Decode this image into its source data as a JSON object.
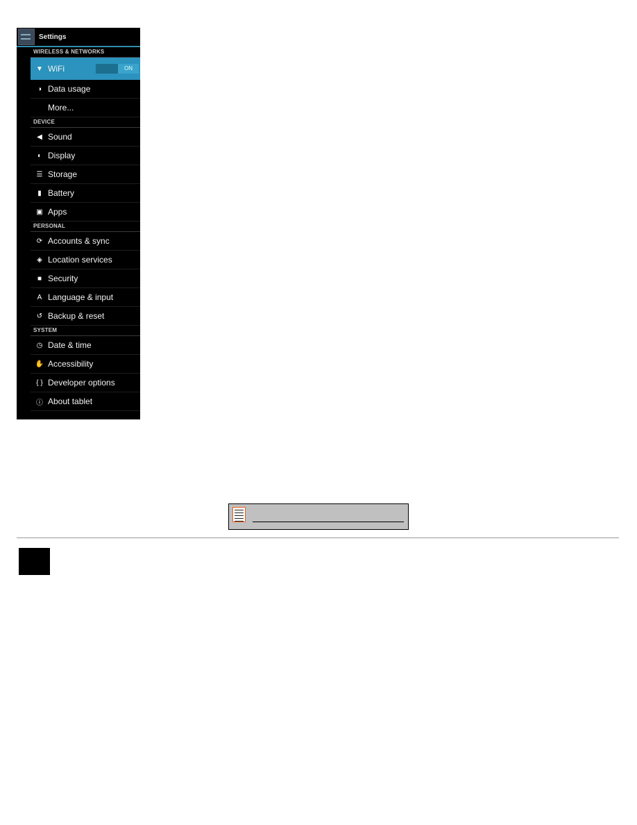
{
  "actionbar": {
    "title": "Settings",
    "icon": "settings-app-icon"
  },
  "sections": [
    {
      "header": "WIRELESS & NETWORKS",
      "items": [
        {
          "label": "WiFi",
          "icon": "wifi-icon",
          "glyph": "▼",
          "active": true,
          "toggle": "ON"
        },
        {
          "label": "Data usage",
          "icon": "data-usage-icon",
          "glyph": "◑"
        },
        {
          "label": "More...",
          "icon": "",
          "glyph": ""
        }
      ]
    },
    {
      "header": "DEVICE",
      "items": [
        {
          "label": "Sound",
          "icon": "sound-icon",
          "glyph": "◀"
        },
        {
          "label": "Display",
          "icon": "display-icon",
          "glyph": "◐"
        },
        {
          "label": "Storage",
          "icon": "storage-icon",
          "glyph": "☰"
        },
        {
          "label": "Battery",
          "icon": "battery-icon",
          "glyph": "▮"
        },
        {
          "label": "Apps",
          "icon": "apps-icon",
          "glyph": "▣"
        }
      ]
    },
    {
      "header": "PERSONAL",
      "items": [
        {
          "label": "Accounts & sync",
          "icon": "sync-icon",
          "glyph": "⟳"
        },
        {
          "label": "Location services",
          "icon": "location-icon",
          "glyph": "◈"
        },
        {
          "label": "Security",
          "icon": "lock-icon",
          "glyph": "■"
        },
        {
          "label": "Language & input",
          "icon": "language-icon",
          "glyph": "A"
        },
        {
          "label": "Backup & reset",
          "icon": "backup-icon",
          "glyph": "↺"
        }
      ]
    },
    {
      "header": "SYSTEM",
      "items": [
        {
          "label": "Date & time",
          "icon": "clock-icon",
          "glyph": "◷"
        },
        {
          "label": "Accessibility",
          "icon": "hand-icon",
          "glyph": "✋"
        },
        {
          "label": "Developer options",
          "icon": "braces-icon",
          "glyph": "{ }"
        },
        {
          "label": "About tablet",
          "icon": "info-icon",
          "glyph": "ⓘ"
        }
      ]
    }
  ],
  "footer": {
    "icon": "document-icon"
  }
}
